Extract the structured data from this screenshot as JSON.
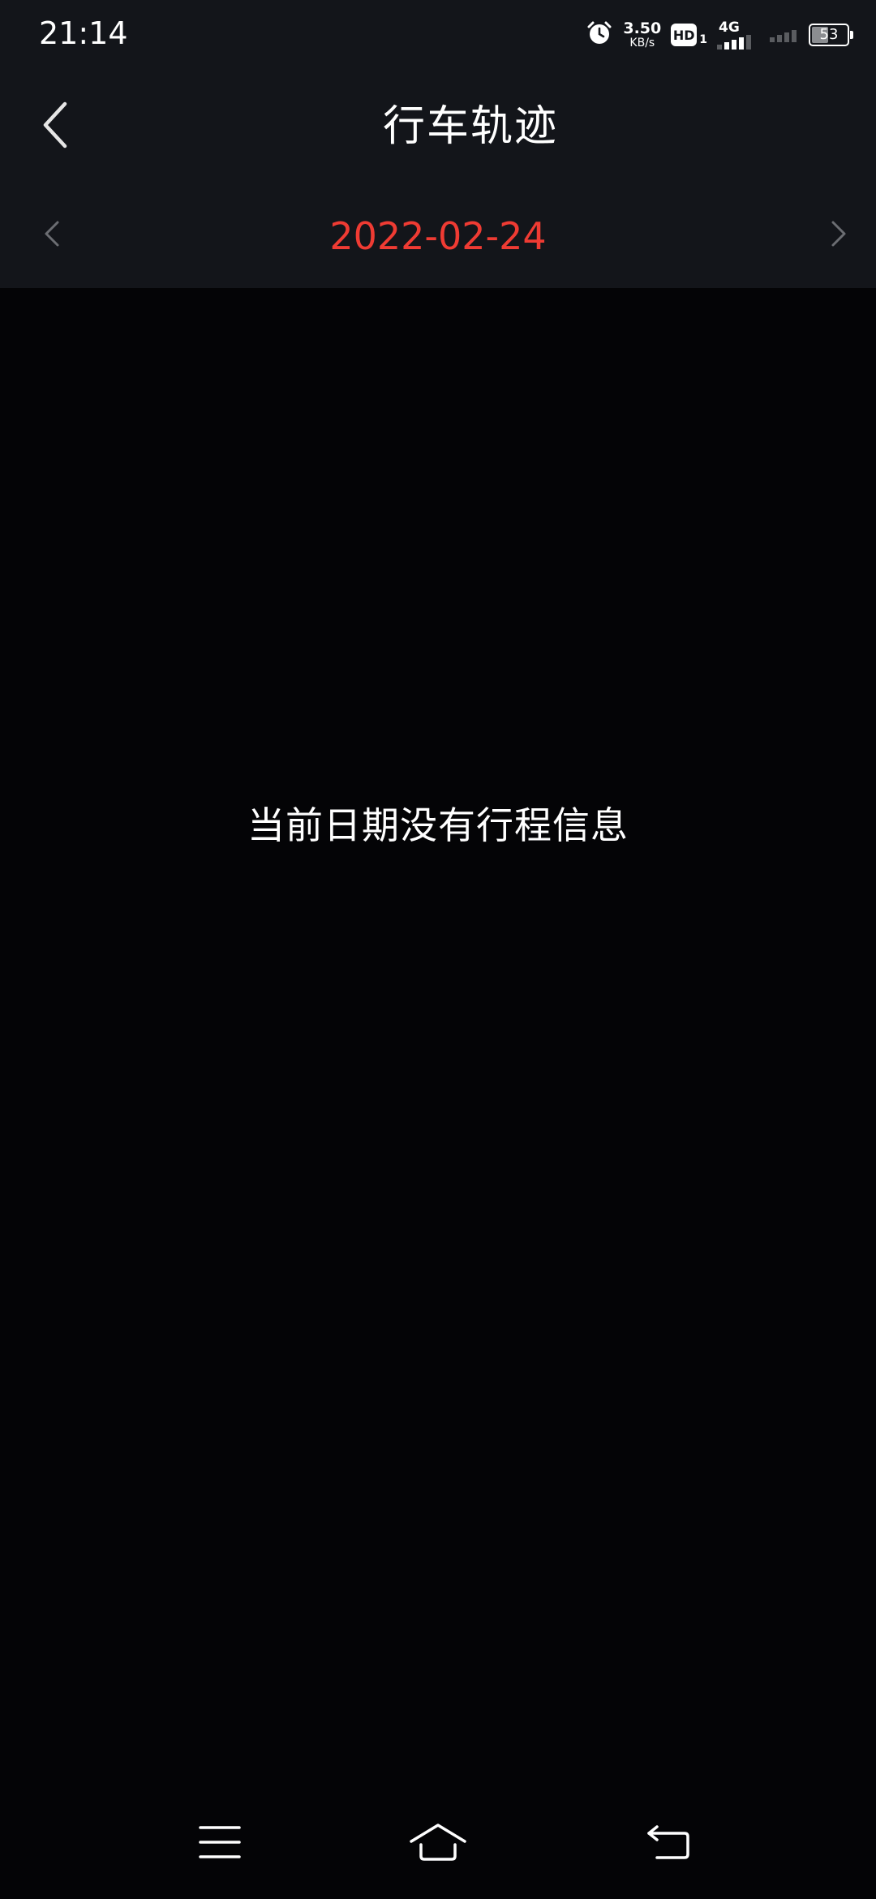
{
  "status_bar": {
    "time": "21:14",
    "net_speed_value": "3.50",
    "net_speed_unit": "KB/s",
    "hd_label": "HD",
    "hd_sub": "1",
    "network_gen": "4G",
    "battery_percent": 53,
    "battery_label": "53"
  },
  "header": {
    "title": "行车轨迹"
  },
  "date_bar": {
    "date": "2022-02-24",
    "date_color": "#ef3b33"
  },
  "content": {
    "empty_message": "当前日期没有行程信息"
  },
  "icons": {
    "back": "chevron-left-icon",
    "prev_date": "chevron-left-icon",
    "next_date": "chevron-right-icon",
    "menu": "menu-icon",
    "home": "home-icon",
    "return": "back-arrow-icon"
  }
}
